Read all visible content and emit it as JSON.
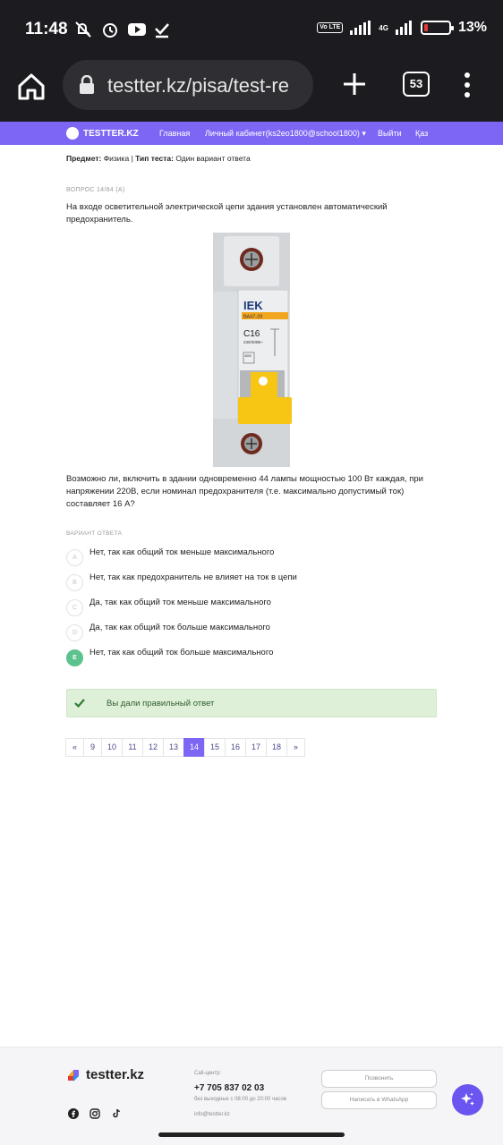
{
  "status_bar": {
    "time": "11:48",
    "network_badge": "Vo LTE",
    "network_type": "4G",
    "battery": "13%",
    "battery_level": 0.13
  },
  "browser": {
    "url": "testter.kz/pisa/test-re",
    "tab_count": "53"
  },
  "site_nav": {
    "logo": "TESTTER.KZ",
    "items": [
      {
        "label": "Главная"
      },
      {
        "label": "Личный кабинет(ks2eo1800@school1800) ▾"
      },
      {
        "label": "Выйти"
      },
      {
        "label": "Қаз"
      }
    ]
  },
  "test_meta": {
    "subject_label": "Предмет:",
    "subject": "Физика",
    "type_label": "Тип теста:",
    "type": "Один вариант ответа"
  },
  "question": {
    "number": "ВОПРОС 14/84 (А)",
    "text": "На входе осветительной электрической цепи здания установлен автоматический предохранитель.",
    "image_labels": {
      "brand": "IEK",
      "model": "ВА47-29",
      "rating": "C16",
      "voltage": "230/400В~",
      "breaking": "4500"
    },
    "text2": "Возможно ли, включить в здании одновременно 44 лампы мощностью 100 Вт каждая, при напряжении 220В, если номинал предохранителя (т.е. максимально допустимый ток) составляет 16 А?"
  },
  "answers": {
    "label": "ВАРИАНТ ОТВЕТА",
    "options": [
      {
        "letter": "A",
        "text": "Нет, так как общий ток меньше максимального"
      },
      {
        "letter": "B",
        "text": "Нет, так как предохранитель не влияет на ток в цепи"
      },
      {
        "letter": "C",
        "text": "Да, так как общий ток меньше максимального"
      },
      {
        "letter": "D",
        "text": "Да, так как общий ток больше максимального"
      },
      {
        "letter": "E",
        "text": "Нет, так как общий ток больше максимального"
      }
    ],
    "selected": "E"
  },
  "result": {
    "text": "Вы дали правильный ответ",
    "color": "#dff0d8"
  },
  "pagination": {
    "prev": "«",
    "pages": [
      "9",
      "10",
      "11",
      "12",
      "13",
      "14",
      "15",
      "16",
      "17",
      "18"
    ],
    "current": "14",
    "next": "»"
  },
  "footer": {
    "logo": "testter.kz",
    "call_center_label": "Call-центр:",
    "phone": "+7 705 837 02 03",
    "hours": "без выходных с 08:00 до 20:00 часов",
    "email": "info@testter.kz",
    "call_button": "Позвонить",
    "whatsapp_button": "Написать в WhatsApp"
  },
  "colors": {
    "brand": "#7e66f4",
    "correct": "#5cc28e",
    "fab": "#6a55f0"
  }
}
